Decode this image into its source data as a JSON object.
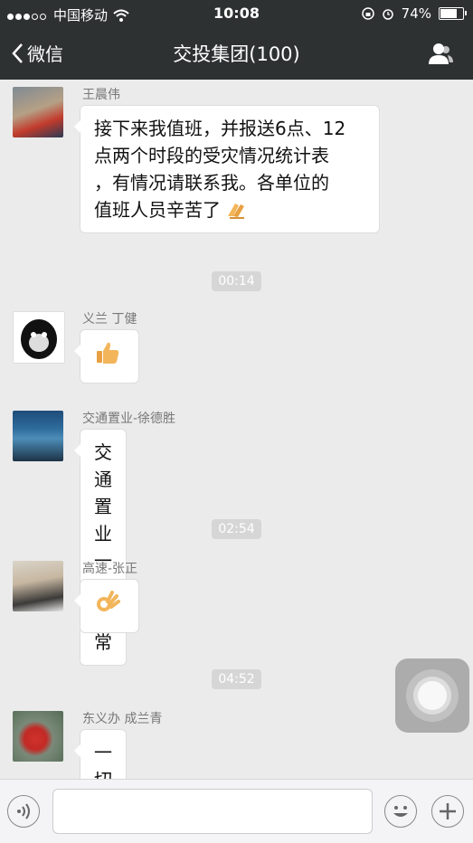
{
  "status_bar": {
    "carrier": "中国移动",
    "time": "10:08",
    "battery": "74%"
  },
  "navbar": {
    "back_label": "微信",
    "title": "交投集团(100)"
  },
  "messages": [
    {
      "sender": "王晨伟",
      "lines": [
        "接下来我值班，并报送6点、12",
        "点两个时段的受灾情况统计表",
        "，有情况请联系我。各单位的",
        "值班人员辛苦了"
      ],
      "emoji_after": "clap-hands-emoji"
    },
    {
      "sender": "义兰 丁健",
      "emoji": "thumbs-up-emoji"
    },
    {
      "sender": "交通置业-徐德胜",
      "text": "交通置业一切正常"
    },
    {
      "sender": "高速-张正",
      "emoji": "ok-hand-emoji"
    },
    {
      "sender": "东义办 成兰青",
      "text": "一切正常"
    }
  ],
  "timestamps": [
    "00:14",
    "02:54",
    "04:52"
  ],
  "icons": {
    "back": "chevron-left-icon",
    "group": "people-icon",
    "voice": "voice-icon",
    "emoji": "smiley-icon",
    "more": "plus-icon"
  }
}
